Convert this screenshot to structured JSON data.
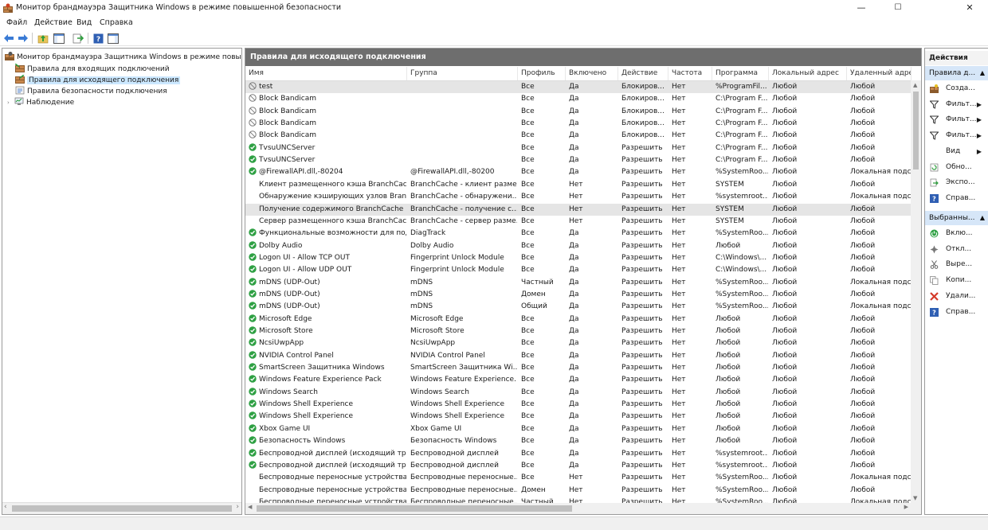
{
  "window": {
    "title": "Монитор брандмауэра Защитника Windows в режиме повышенной безопасности",
    "minimize": "—",
    "maximize": "☐",
    "close": "✕"
  },
  "menu": [
    "Файл",
    "Действие",
    "Вид",
    "Справка"
  ],
  "tree": {
    "root": "Монитор брандмауэра Защитника Windows в режиме повышен",
    "items": [
      {
        "label": "Правила для входящих подключений"
      },
      {
        "label": "Правила для исходящего подключения",
        "selected": true
      },
      {
        "label": "Правила безопасности подключения"
      },
      {
        "label": "Наблюдение"
      }
    ],
    "scroll_left": "‹",
    "scroll_right": "›"
  },
  "panel": {
    "title": "Правила для исходящего подключения",
    "columns": [
      "Имя",
      "Группа",
      "Профиль",
      "Включено",
      "Действие",
      "Частота",
      "Программа",
      "Локальный адрес",
      "Удаленный адрес"
    ],
    "scroll_up": "▲",
    "scroll_down": "▼",
    "scroll_left": "◀",
    "scroll_right": "▶"
  },
  "rows": [
    {
      "icon": "blocked",
      "name": "test",
      "group": "",
      "profile": "Все",
      "enabled": "Да",
      "action": "Блокиров...",
      "override": "Нет",
      "program": "%ProgramFil...",
      "local": "Любой",
      "remote": "Любой",
      "selected": true
    },
    {
      "icon": "blocked",
      "name": "Block Bandicam",
      "group": "",
      "profile": "Все",
      "enabled": "Да",
      "action": "Блокиров...",
      "override": "Нет",
      "program": "C:\\Program F...",
      "local": "Любой",
      "remote": "Любой"
    },
    {
      "icon": "blocked",
      "name": "Block Bandicam",
      "group": "",
      "profile": "Все",
      "enabled": "Да",
      "action": "Блокиров...",
      "override": "Нет",
      "program": "C:\\Program F...",
      "local": "Любой",
      "remote": "Любой"
    },
    {
      "icon": "blocked",
      "name": "Block Bandicam",
      "group": "",
      "profile": "Все",
      "enabled": "Да",
      "action": "Блокиров...",
      "override": "Нет",
      "program": "C:\\Program F...",
      "local": "Любой",
      "remote": "Любой"
    },
    {
      "icon": "blocked",
      "name": "Block Bandicam",
      "group": "",
      "profile": "Все",
      "enabled": "Да",
      "action": "Блокиров...",
      "override": "Нет",
      "program": "C:\\Program F...",
      "local": "Любой",
      "remote": "Любой"
    },
    {
      "icon": "allowed",
      "name": "TvsuUNCServer",
      "group": "",
      "profile": "Все",
      "enabled": "Да",
      "action": "Разрешить",
      "override": "Нет",
      "program": "C:\\Program F...",
      "local": "Любой",
      "remote": "Любой"
    },
    {
      "icon": "allowed",
      "name": "TvsuUNCServer",
      "group": "",
      "profile": "Все",
      "enabled": "Да",
      "action": "Разрешить",
      "override": "Нет",
      "program": "C:\\Program F...",
      "local": "Любой",
      "remote": "Любой"
    },
    {
      "icon": "allowed",
      "name": "@FirewallAPI.dll,-80204",
      "group": "@FirewallAPI.dll,-80200",
      "profile": "Все",
      "enabled": "Да",
      "action": "Разрешить",
      "override": "Нет",
      "program": "%SystemRoo...",
      "local": "Любой",
      "remote": "Локальная подсеть"
    },
    {
      "icon": "none",
      "name": "Клиент размещенного кэша BranchCach...",
      "group": "BranchCache - клиент разме...",
      "profile": "Все",
      "enabled": "Нет",
      "action": "Разрешить",
      "override": "Нет",
      "program": "SYSTEM",
      "local": "Любой",
      "remote": "Любой"
    },
    {
      "icon": "none",
      "name": "Обнаружение кэширующих узлов Branc...",
      "group": "BranchCache - обнаружени...",
      "profile": "Все",
      "enabled": "Нет",
      "action": "Разрешить",
      "override": "Нет",
      "program": "%systemroot...",
      "local": "Любой",
      "remote": "Локальная подсеть"
    },
    {
      "icon": "none",
      "name": "Получение содержимого BranchCache (...",
      "group": "BranchCache - получение с...",
      "profile": "Все",
      "enabled": "Нет",
      "action": "Разрешить",
      "override": "Нет",
      "program": "SYSTEM",
      "local": "Любой",
      "remote": "Любой",
      "selected": true
    },
    {
      "icon": "none",
      "name": "Сервер размещенного кэша BranchCach...",
      "group": "BranchCache - сервер разме...",
      "profile": "Все",
      "enabled": "Нет",
      "action": "Разрешить",
      "override": "Нет",
      "program": "SYSTEM",
      "local": "Любой",
      "remote": "Любой"
    },
    {
      "icon": "allowed",
      "name": "Функциональные возможности для под...",
      "group": "DiagTrack",
      "profile": "Все",
      "enabled": "Да",
      "action": "Разрешить",
      "override": "Нет",
      "program": "%SystemRoo...",
      "local": "Любой",
      "remote": "Любой"
    },
    {
      "icon": "allowed",
      "name": "Dolby Audio",
      "group": "Dolby Audio",
      "profile": "Все",
      "enabled": "Да",
      "action": "Разрешить",
      "override": "Нет",
      "program": "Любой",
      "local": "Любой",
      "remote": "Любой"
    },
    {
      "icon": "allowed",
      "name": "Logon UI - Allow TCP OUT",
      "group": "Fingerprint Unlock Module",
      "profile": "Все",
      "enabled": "Да",
      "action": "Разрешить",
      "override": "Нет",
      "program": "C:\\Windows\\...",
      "local": "Любой",
      "remote": "Любой"
    },
    {
      "icon": "allowed",
      "name": "Logon UI - Allow UDP OUT",
      "group": "Fingerprint Unlock Module",
      "profile": "Все",
      "enabled": "Да",
      "action": "Разрешить",
      "override": "Нет",
      "program": "C:\\Windows\\...",
      "local": "Любой",
      "remote": "Любой"
    },
    {
      "icon": "allowed",
      "name": "mDNS (UDP-Out)",
      "group": "mDNS",
      "profile": "Частный",
      "enabled": "Да",
      "action": "Разрешить",
      "override": "Нет",
      "program": "%SystemRoo...",
      "local": "Любой",
      "remote": "Локальная подсеть"
    },
    {
      "icon": "allowed",
      "name": "mDNS (UDP-Out)",
      "group": "mDNS",
      "profile": "Домен",
      "enabled": "Да",
      "action": "Разрешить",
      "override": "Нет",
      "program": "%SystemRoo...",
      "local": "Любой",
      "remote": "Любой"
    },
    {
      "icon": "allowed",
      "name": "mDNS (UDP-Out)",
      "group": "mDNS",
      "profile": "Общий",
      "enabled": "Да",
      "action": "Разрешить",
      "override": "Нет",
      "program": "%SystemRoo...",
      "local": "Любой",
      "remote": "Локальная подсеть"
    },
    {
      "icon": "allowed",
      "name": "Microsoft Edge",
      "group": "Microsoft Edge",
      "profile": "Все",
      "enabled": "Да",
      "action": "Разрешить",
      "override": "Нет",
      "program": "Любой",
      "local": "Любой",
      "remote": "Любой"
    },
    {
      "icon": "allowed",
      "name": "Microsoft Store",
      "group": "Microsoft Store",
      "profile": "Все",
      "enabled": "Да",
      "action": "Разрешить",
      "override": "Нет",
      "program": "Любой",
      "local": "Любой",
      "remote": "Любой"
    },
    {
      "icon": "allowed",
      "name": "NcsiUwpApp",
      "group": "NcsiUwpApp",
      "profile": "Все",
      "enabled": "Да",
      "action": "Разрешить",
      "override": "Нет",
      "program": "Любой",
      "local": "Любой",
      "remote": "Любой"
    },
    {
      "icon": "allowed",
      "name": "NVIDIA Control Panel",
      "group": "NVIDIA Control Panel",
      "profile": "Все",
      "enabled": "Да",
      "action": "Разрешить",
      "override": "Нет",
      "program": "Любой",
      "local": "Любой",
      "remote": "Любой"
    },
    {
      "icon": "allowed",
      "name": "SmartScreen Защитника Windows",
      "group": "SmartScreen Защитника Wi...",
      "profile": "Все",
      "enabled": "Да",
      "action": "Разрешить",
      "override": "Нет",
      "program": "Любой",
      "local": "Любой",
      "remote": "Любой"
    },
    {
      "icon": "allowed",
      "name": "Windows Feature Experience Pack",
      "group": "Windows Feature Experience...",
      "profile": "Все",
      "enabled": "Да",
      "action": "Разрешить",
      "override": "Нет",
      "program": "Любой",
      "local": "Любой",
      "remote": "Любой"
    },
    {
      "icon": "allowed",
      "name": "Windows Search",
      "group": "Windows Search",
      "profile": "Все",
      "enabled": "Да",
      "action": "Разрешить",
      "override": "Нет",
      "program": "Любой",
      "local": "Любой",
      "remote": "Любой"
    },
    {
      "icon": "allowed",
      "name": "Windows Shell Experience",
      "group": "Windows Shell Experience",
      "profile": "Все",
      "enabled": "Да",
      "action": "Разрешить",
      "override": "Нет",
      "program": "Любой",
      "local": "Любой",
      "remote": "Любой"
    },
    {
      "icon": "allowed",
      "name": "Windows Shell Experience",
      "group": "Windows Shell Experience",
      "profile": "Все",
      "enabled": "Да",
      "action": "Разрешить",
      "override": "Нет",
      "program": "Любой",
      "local": "Любой",
      "remote": "Любой"
    },
    {
      "icon": "allowed",
      "name": "Xbox Game UI",
      "group": "Xbox Game UI",
      "profile": "Все",
      "enabled": "Да",
      "action": "Разрешить",
      "override": "Нет",
      "program": "Любой",
      "local": "Любой",
      "remote": "Любой"
    },
    {
      "icon": "allowed",
      "name": "Безопасность Windows",
      "group": "Безопасность Windows",
      "profile": "Все",
      "enabled": "Да",
      "action": "Разрешить",
      "override": "Нет",
      "program": "Любой",
      "local": "Любой",
      "remote": "Любой"
    },
    {
      "icon": "allowed",
      "name": "Беспроводной дисплей (исходящий тра...",
      "group": "Беспроводной дисплей",
      "profile": "Все",
      "enabled": "Да",
      "action": "Разрешить",
      "override": "Нет",
      "program": "%systemroot...",
      "local": "Любой",
      "remote": "Любой"
    },
    {
      "icon": "allowed",
      "name": "Беспроводной дисплей (исходящий тра...",
      "group": "Беспроводной дисплей",
      "profile": "Все",
      "enabled": "Да",
      "action": "Разрешить",
      "override": "Нет",
      "program": "%systemroot...",
      "local": "Любой",
      "remote": "Любой"
    },
    {
      "icon": "none",
      "name": "Беспроводные переносные устройства (...",
      "group": "Беспроводные переносные...",
      "profile": "Все",
      "enabled": "Нет",
      "action": "Разрешить",
      "override": "Нет",
      "program": "%SystemRoo...",
      "local": "Любой",
      "remote": "Локальная подсеть"
    },
    {
      "icon": "none",
      "name": "Беспроводные переносные устройства (...",
      "group": "Беспроводные переносные...",
      "profile": "Домен",
      "enabled": "Нет",
      "action": "Разрешить",
      "override": "Нет",
      "program": "%SystemRoo...",
      "local": "Любой",
      "remote": "Любой"
    },
    {
      "icon": "none",
      "name": "Беспроводные переносные устройства (...",
      "group": "Беспроводные переносные...",
      "profile": "Частный",
      "enabled": "Нет",
      "action": "Разрешить",
      "override": "Нет",
      "program": "%SystemRoo...",
      "local": "Любой",
      "remote": "Локальная подсеть"
    }
  ],
  "actions": {
    "header": "Действия",
    "section1": "Правила д...",
    "section1_items": [
      {
        "icon": "new-rule-icon",
        "label": "Созда...",
        "submenu": false
      },
      {
        "icon": "filter-icon",
        "label": "Фильт...",
        "submenu": true
      },
      {
        "icon": "filter-icon",
        "label": "Фильт...",
        "submenu": true
      },
      {
        "icon": "filter-icon",
        "label": "Фильт...",
        "submenu": true
      },
      {
        "icon": "none",
        "label": "Вид",
        "submenu": true
      },
      {
        "icon": "refresh-icon",
        "label": "Обно...",
        "submenu": false
      },
      {
        "icon": "export-icon",
        "label": "Экспо...",
        "submenu": false
      },
      {
        "icon": "help-icon",
        "label": "Справ...",
        "submenu": false
      }
    ],
    "section2": "Выбранны...",
    "section2_items": [
      {
        "icon": "enable-icon",
        "label": "Вклю...",
        "submenu": false
      },
      {
        "icon": "disable-icon",
        "label": "Откл...",
        "submenu": false
      },
      {
        "icon": "cut-icon",
        "label": "Выре...",
        "submenu": false
      },
      {
        "icon": "copy-icon",
        "label": "Копи...",
        "submenu": false
      },
      {
        "icon": "delete-icon",
        "label": "Удали...",
        "submenu": false
      },
      {
        "icon": "help-icon",
        "label": "Справ...",
        "submenu": false
      }
    ],
    "collapse_arrow": "▲",
    "submenu_arrow": "▶"
  },
  "colors": {
    "panel_header_bg": "#6e6e6e",
    "selection_bg": "#cce8ff",
    "allow_green": "#2ea043",
    "block_gray": "#7a7a7a",
    "actions_section_bg": "#d6e6f8"
  }
}
